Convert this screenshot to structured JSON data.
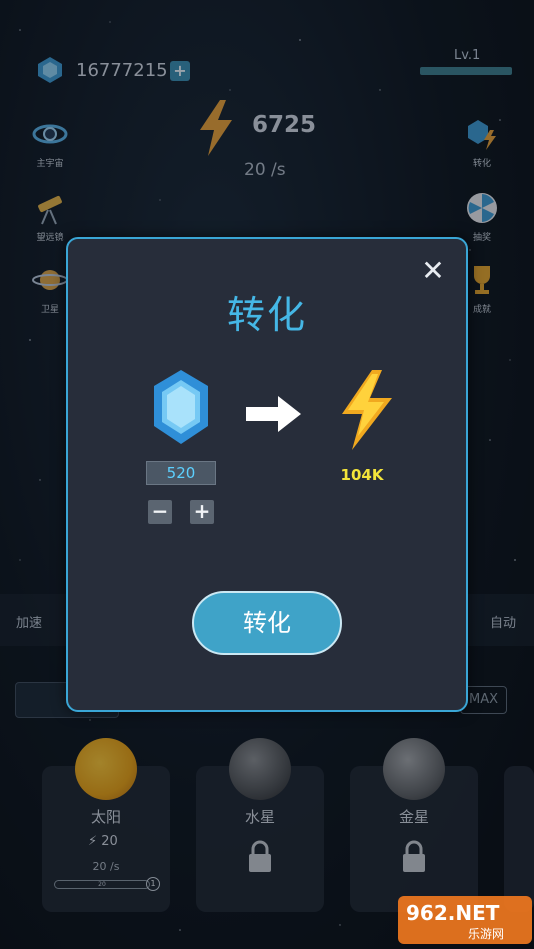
{
  "top": {
    "gems": "16777215",
    "level": "Lv.1",
    "energy": "6725",
    "rate": "20 /s"
  },
  "side_left": [
    {
      "label": "主宇宙",
      "icon": "galaxy-icon"
    },
    {
      "label": "望远镜",
      "icon": "telescope-icon"
    },
    {
      "label": "卫星",
      "icon": "saturn-icon"
    }
  ],
  "side_right": [
    {
      "label": "转化",
      "icon": "convert-icon"
    },
    {
      "label": "抽奖",
      "icon": "lottery-icon"
    },
    {
      "label": "成就",
      "icon": "trophy-icon"
    }
  ],
  "speed_row": {
    "speed_label": "加速",
    "auto_label": "自动"
  },
  "bottom": {
    "max_label": "MAX",
    "planets": [
      {
        "name": "太阳",
        "energy": "20",
        "rate": "20 /s",
        "progress_text": "20",
        "level": "1",
        "locked": false,
        "color": "#e6a21a"
      },
      {
        "name": "水星",
        "locked": true,
        "color": "#5a5e63"
      },
      {
        "name": "金星",
        "locked": true,
        "color": "#6b6f74"
      }
    ]
  },
  "dialog": {
    "title": "转化",
    "gem_amount": "520",
    "result": "104K",
    "minus_label": "−",
    "plus_label": "+",
    "close_label": "✕",
    "convert_label": "转化"
  },
  "watermark": {
    "brand": "962.NET",
    "sub": "乐游网"
  },
  "colors": {
    "accent": "#45b7e6",
    "button": "#3fa3c8",
    "result": "#f3e43a",
    "dialog_bg": "#272d3a"
  }
}
